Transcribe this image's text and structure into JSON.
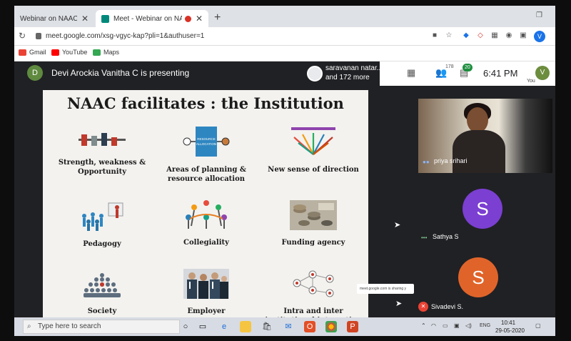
{
  "browser": {
    "tabs": [
      {
        "label": "Webinar on NAAC Acc"
      },
      {
        "label": "Meet - Webinar on NAAC Ac"
      }
    ],
    "new_tab": "+",
    "url": "meet.google.com/xsg-vgyc-kap?pli=1&authuser=1",
    "profile_initial": "V",
    "bookmarks": [
      {
        "label": "Gmail",
        "color": "#ea4335"
      },
      {
        "label": "YouTube",
        "color": "#ff0000"
      },
      {
        "label": "Maps",
        "color": "#34a853"
      }
    ]
  },
  "meet": {
    "presenter_initial": "D",
    "presenting_text": "Devi Arockia Vanitha C is presenting",
    "participants_line1": "saravanan natar...",
    "participants_line2": "and 172 more",
    "people_count": "178",
    "chat_count": "20",
    "time": "6:41 PM",
    "self_initial": "V",
    "self_label": "You"
  },
  "slide": {
    "title": "NAAC facilitates : the Institution",
    "items": [
      {
        "label": "Strength, weakness & Opportunity",
        "icon": "swot-chart"
      },
      {
        "label": "Areas of planning & resource allocation",
        "icon": "resource-allocation-box",
        "box_text": "RESOURCE ALLOCATION"
      },
      {
        "label": "New sense of direction",
        "icon": "direction-arrows"
      },
      {
        "label": "Pedagogy",
        "icon": "classroom-figures"
      },
      {
        "label": "Collegiality",
        "icon": "people-circle"
      },
      {
        "label": "Funding agency",
        "icon": "coins-money"
      },
      {
        "label": "Society",
        "icon": "crowd"
      },
      {
        "label": "Employer",
        "icon": "business-people"
      },
      {
        "label": "Intra and inter institutional interaction",
        "icon": "network"
      }
    ]
  },
  "participants": [
    {
      "name": "priya srihari",
      "type": "camera"
    },
    {
      "name": "Sathya S",
      "initial": "S",
      "color": "#7b3fd2"
    },
    {
      "name": "Sivadevi S.",
      "initial": "S",
      "color": "#e0642a"
    }
  ],
  "sharing_notice": "meet.google.com is sharing y",
  "taskbar": {
    "search_placeholder": "Type here to search",
    "language": "ENG",
    "time": "10:41",
    "date": "29-05-2020"
  },
  "colors": {
    "meet_dark": "#202124",
    "slide_bg": "#f3f2ef",
    "accent_blue": "#1a73e8"
  }
}
